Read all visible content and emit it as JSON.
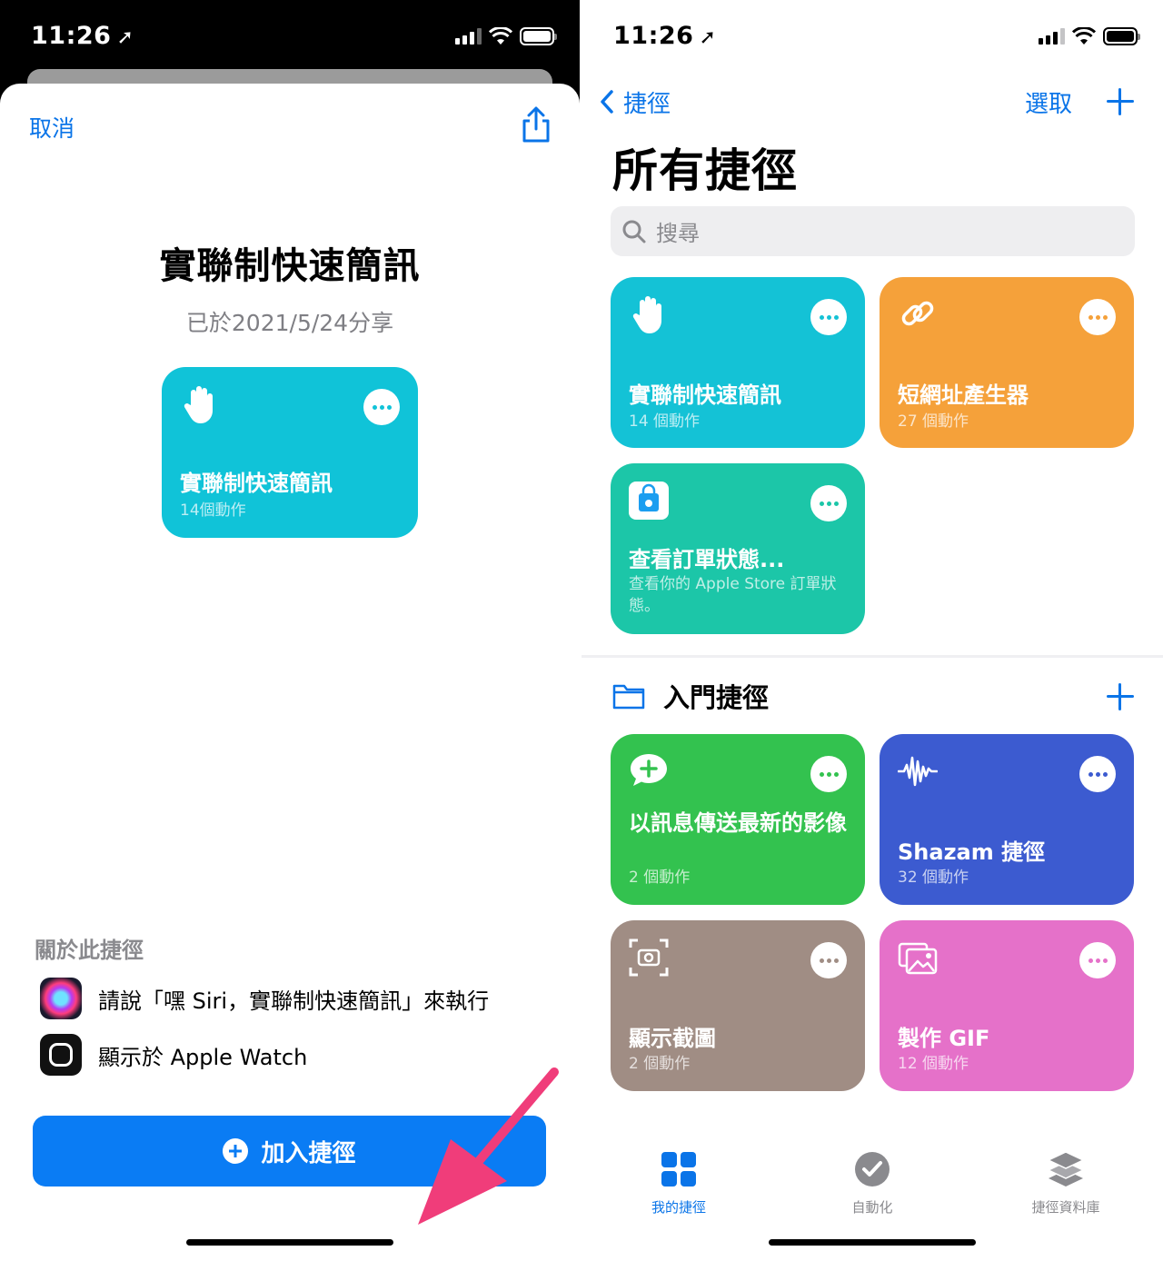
{
  "status_bar": {
    "time": "11:26"
  },
  "left": {
    "cancel": "取消",
    "shortcut_title": "實聯制快速簡訊",
    "shared_date": "已於2021/5/24分享",
    "card": {
      "title": "實聯制快速簡訊",
      "actions": "14個動作",
      "color": "#10c3d8",
      "icon": "hand-icon"
    },
    "about": {
      "heading": "關於此捷徑",
      "siri": "請說「嘿 Siri，實聯制快速簡訊」來執行",
      "watch": "顯示於 Apple Watch"
    },
    "add_button": "加入捷徑",
    "arrow_color": "#f03d7a"
  },
  "right": {
    "back_label": "捷徑",
    "select_label": "選取",
    "title": "所有捷徑",
    "search_placeholder": "搜尋",
    "shortcuts": [
      {
        "title": "實聯制快速簡訊",
        "subtitle": "14 個動作",
        "color": "#14c2d6",
        "icon": "hand-icon"
      },
      {
        "title": "短網址產生器",
        "subtitle": "27 個動作",
        "color": "#f5a13a",
        "icon": "link-icon"
      },
      {
        "title": "查看訂單狀態...",
        "subtitle": "查看你的 Apple Store 訂單狀態。",
        "color": "#1cc6a8",
        "icon": "apple-store-bag-icon"
      }
    ],
    "folder": {
      "name": "入門捷徑",
      "items": [
        {
          "title": "以訊息傳送最新的影像",
          "subtitle": "2 個動作",
          "color": "#33c24f",
          "icon": "message-plus-icon"
        },
        {
          "title": "Shazam 捷徑",
          "subtitle": "32 個動作",
          "color": "#3c5bd0",
          "icon": "waveform-icon"
        },
        {
          "title": "顯示截圖",
          "subtitle": "2 個動作",
          "color": "#a08d84",
          "icon": "screenshot-icon"
        },
        {
          "title": "製作 GIF",
          "subtitle": "12 個動作",
          "color": "#e571c9",
          "icon": "photos-icon"
        }
      ]
    },
    "tabs": [
      {
        "label": "我的捷徑",
        "active": true
      },
      {
        "label": "自動化",
        "active": false
      },
      {
        "label": "捷徑資料庫",
        "active": false
      }
    ]
  },
  "colors": {
    "accent": "#0a74e8",
    "button": "#0a7cf4"
  }
}
